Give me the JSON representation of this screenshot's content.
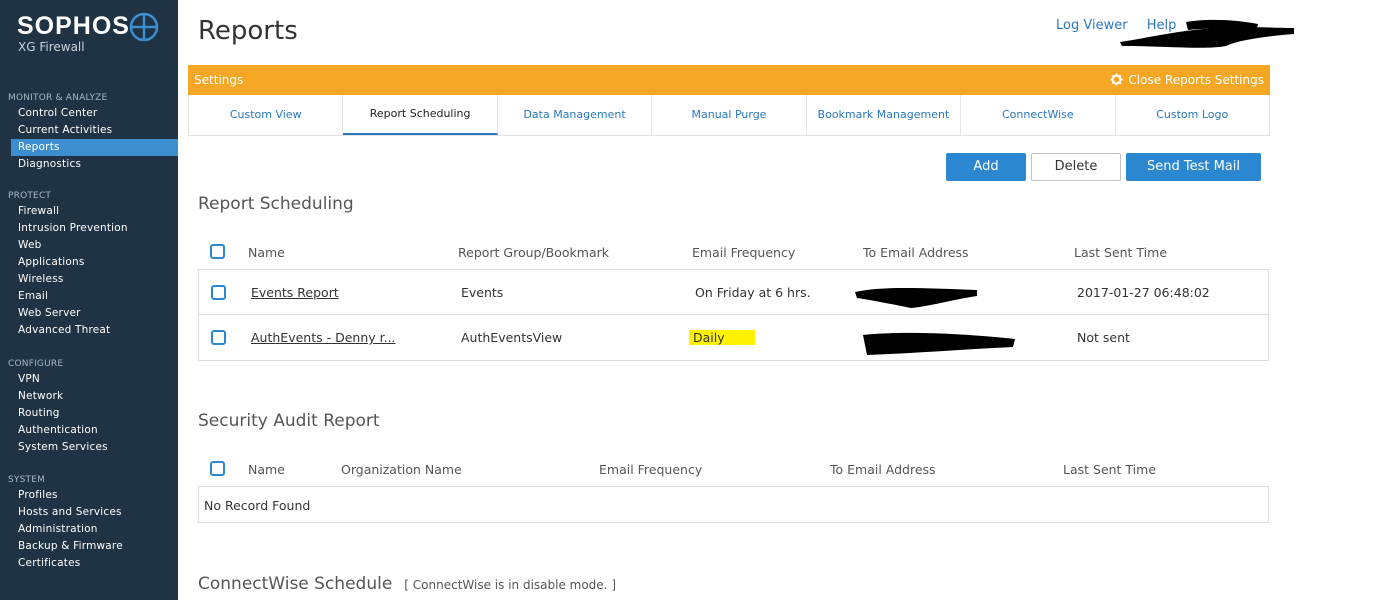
{
  "brand": {
    "name": "SOPHOS",
    "product": "XG Firewall"
  },
  "sidebar": {
    "sections": [
      {
        "heading": "MONITOR & ANALYZE",
        "items": [
          "Control Center",
          "Current Activities",
          "Reports",
          "Diagnostics"
        ]
      },
      {
        "heading": "PROTECT",
        "items": [
          "Firewall",
          "Intrusion Prevention",
          "Web",
          "Applications",
          "Wireless",
          "Email",
          "Web Server",
          "Advanced Threat"
        ]
      },
      {
        "heading": "CONFIGURE",
        "items": [
          "VPN",
          "Network",
          "Routing",
          "Authentication",
          "System Services"
        ]
      },
      {
        "heading": "SYSTEM",
        "items": [
          "Profiles",
          "Hosts and Services",
          "Administration",
          "Backup & Firmware",
          "Certificates"
        ]
      }
    ],
    "active_item": "Reports"
  },
  "header": {
    "title": "Reports",
    "log_viewer": "Log Viewer",
    "help": "Help"
  },
  "settings_bar": {
    "label": "Settings",
    "close_label": "Close Reports Settings"
  },
  "tabs": [
    "Custom View",
    "Report Scheduling",
    "Data Management",
    "Manual Purge",
    "Bookmark Management",
    "ConnectWise",
    "Custom Logo"
  ],
  "active_tab": "Report Scheduling",
  "actions": {
    "add": "Add",
    "delete": "Delete",
    "send_test_mail": "Send Test Mail"
  },
  "report_scheduling": {
    "title": "Report Scheduling",
    "columns": [
      "Name",
      "Report Group/Bookmark",
      "Email Frequency",
      "To Email Address",
      "Last Sent Time"
    ],
    "rows": [
      {
        "name": "Events Report",
        "group": "Events",
        "frequency": "On Friday at 6 hrs.",
        "email": "",
        "last_sent": "2017-01-27 06:48:02"
      },
      {
        "name": "AuthEvents - Denny r...",
        "group": "AuthEventsView",
        "frequency": "Daily",
        "email": "",
        "last_sent": "Not sent"
      }
    ]
  },
  "security_audit": {
    "title": "Security Audit Report",
    "columns": [
      "Name",
      "Organization Name",
      "Email Frequency",
      "To Email Address",
      "Last Sent Time"
    ],
    "empty_text": "No Record Found"
  },
  "connectwise": {
    "title": "ConnectWise Schedule",
    "note": "[ ConnectWise is in disable mode. ]"
  },
  "colors": {
    "sidebar": "#1f3344",
    "accent": "#2a87d0",
    "settings_bar": "#f5a623",
    "highlight": "#fff200"
  }
}
